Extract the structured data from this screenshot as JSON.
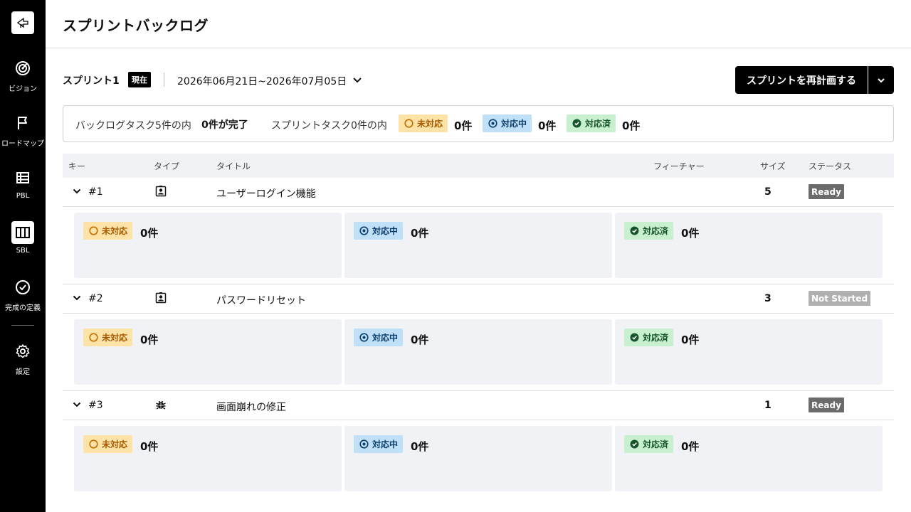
{
  "sidebar": {
    "items": [
      {
        "label": "ビジョン",
        "icon": "target-icon"
      },
      {
        "label": "ロードマップ",
        "icon": "flag-icon"
      },
      {
        "label": "PBL",
        "icon": "list-icon"
      },
      {
        "label": "SBL",
        "icon": "columns-icon"
      },
      {
        "label": "完成の定義",
        "icon": "check-circle-icon"
      },
      {
        "label": "設定",
        "icon": "gear-icon"
      }
    ],
    "active": "SBL"
  },
  "header": {
    "title": "スプリントバックログ"
  },
  "sprint": {
    "name": "スプリント1",
    "current_tag": "現在",
    "dates": "2026年06月21日~2026年07月05日",
    "replan_button": "スプリントを再計画する"
  },
  "summary": {
    "backlog_text": "バックログタスク5件の内",
    "done_text": "0件が完了",
    "sprint_text": "スプリントタスク0件の内",
    "todo_count": "0件",
    "doing_count": "0件",
    "done_count": "0件"
  },
  "status_labels": {
    "todo": "未対応",
    "doing": "対応中",
    "done": "対応済"
  },
  "table": {
    "headers": {
      "key": "キー",
      "type": "タイプ",
      "title": "タイトル",
      "feature": "フィーチャー",
      "size": "サイズ",
      "status": "ステータス"
    },
    "rows": [
      {
        "key": "#1",
        "type": "user-story-icon",
        "title": "ユーザーログイン機能",
        "feature": "",
        "size": "5",
        "status": "Ready",
        "lanes": {
          "todo": "0件",
          "doing": "0件",
          "done": "0件"
        }
      },
      {
        "key": "#2",
        "type": "user-story-icon",
        "title": "パスワードリセット",
        "feature": "",
        "size": "3",
        "status": "Not Started",
        "lanes": {
          "todo": "0件",
          "doing": "0件",
          "done": "0件"
        }
      },
      {
        "key": "#3",
        "type": "bug-icon",
        "title": "画面崩れの修正",
        "feature": "",
        "size": "1",
        "status": "Ready",
        "lanes": {
          "todo": "0件",
          "doing": "0件",
          "done": "0件"
        }
      }
    ]
  },
  "colors": {
    "todo_bg": "#fde3a7",
    "doing_bg": "#bfe0f7",
    "done_bg": "#c8efcf",
    "ready": "#6b6b6b",
    "not_started": "#b0b0b0"
  }
}
